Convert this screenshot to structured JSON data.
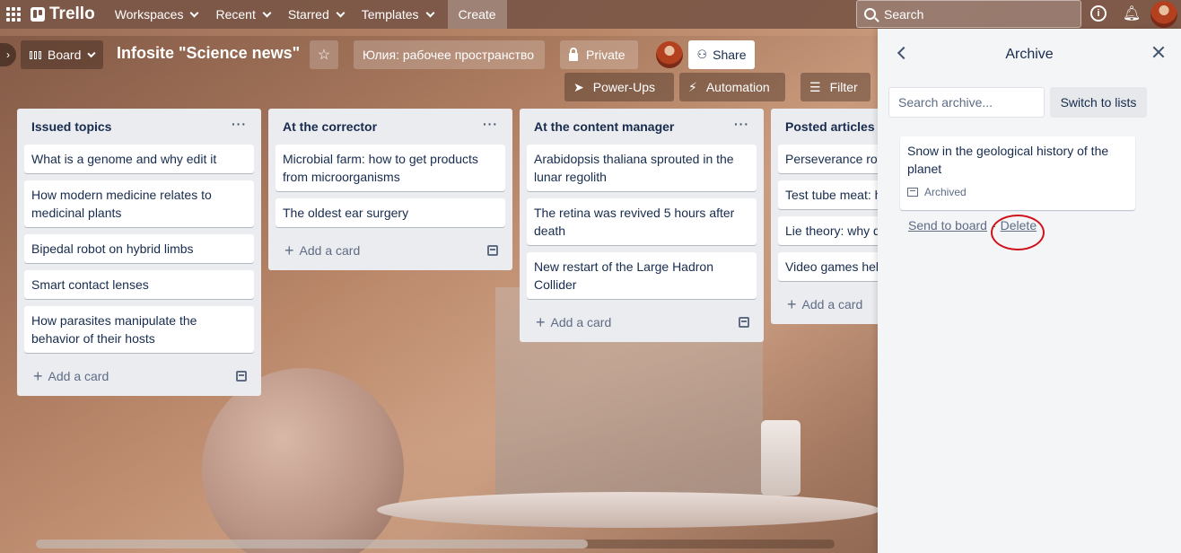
{
  "topnav": {
    "logo": "Trello",
    "menu": [
      "Workspaces",
      "Recent",
      "Starred",
      "Templates"
    ],
    "create_label": "Create",
    "search_placeholder": "Search"
  },
  "board": {
    "view_label": "Board",
    "title": "Infosite \"Science news\"",
    "workspace_label": "Юлия: рабочее пространство",
    "visibility_label": "Private",
    "share_label": "Share",
    "powerups_label": "Power-Ups",
    "automation_label": "Automation",
    "filter_label": "Filter"
  },
  "lists": [
    {
      "title": "Issued topics",
      "cards": [
        "What is a genome and why edit it",
        "How modern medicine relates to medicinal plants",
        "Bipedal robot on hybrid limbs",
        "Smart contact lenses",
        "How parasites manipulate the behavior of their hosts"
      ],
      "add_label": "Add a card"
    },
    {
      "title": "At the corrector",
      "cards": [
        "Microbial farm: how to get products from microorganisms",
        "The oldest ear surgery"
      ],
      "add_label": "Add a card"
    },
    {
      "title": "At the content manager",
      "cards": [
        "Arabidopsis thaliana sprouted in the lunar regolith",
        "The retina was revived 5 hours after death",
        "New restart of the Large Hadron Collider"
      ],
      "add_label": "Add a card"
    },
    {
      "title": "Posted articles",
      "cards": [
        "Perseverance rov speed of sound o",
        "Test tube meat: h perspectives",
        "Lie theory: why d",
        "Video games hel intelligence"
      ],
      "add_label": "Add a card"
    }
  ],
  "archive": {
    "title": "Archive",
    "search_placeholder": "Search archive...",
    "switch_label": "Switch to lists",
    "card_title": "Snow in the geological history of the planet",
    "card_badge": "Archived",
    "send_label": "Send to board",
    "separator": "-",
    "delete_label": "Delete"
  },
  "colors": {
    "nav_bg": "#7a5646",
    "list_bg": "#ebecf0",
    "panel_bg": "#f4f5f7",
    "highlight": "#d0121b"
  }
}
